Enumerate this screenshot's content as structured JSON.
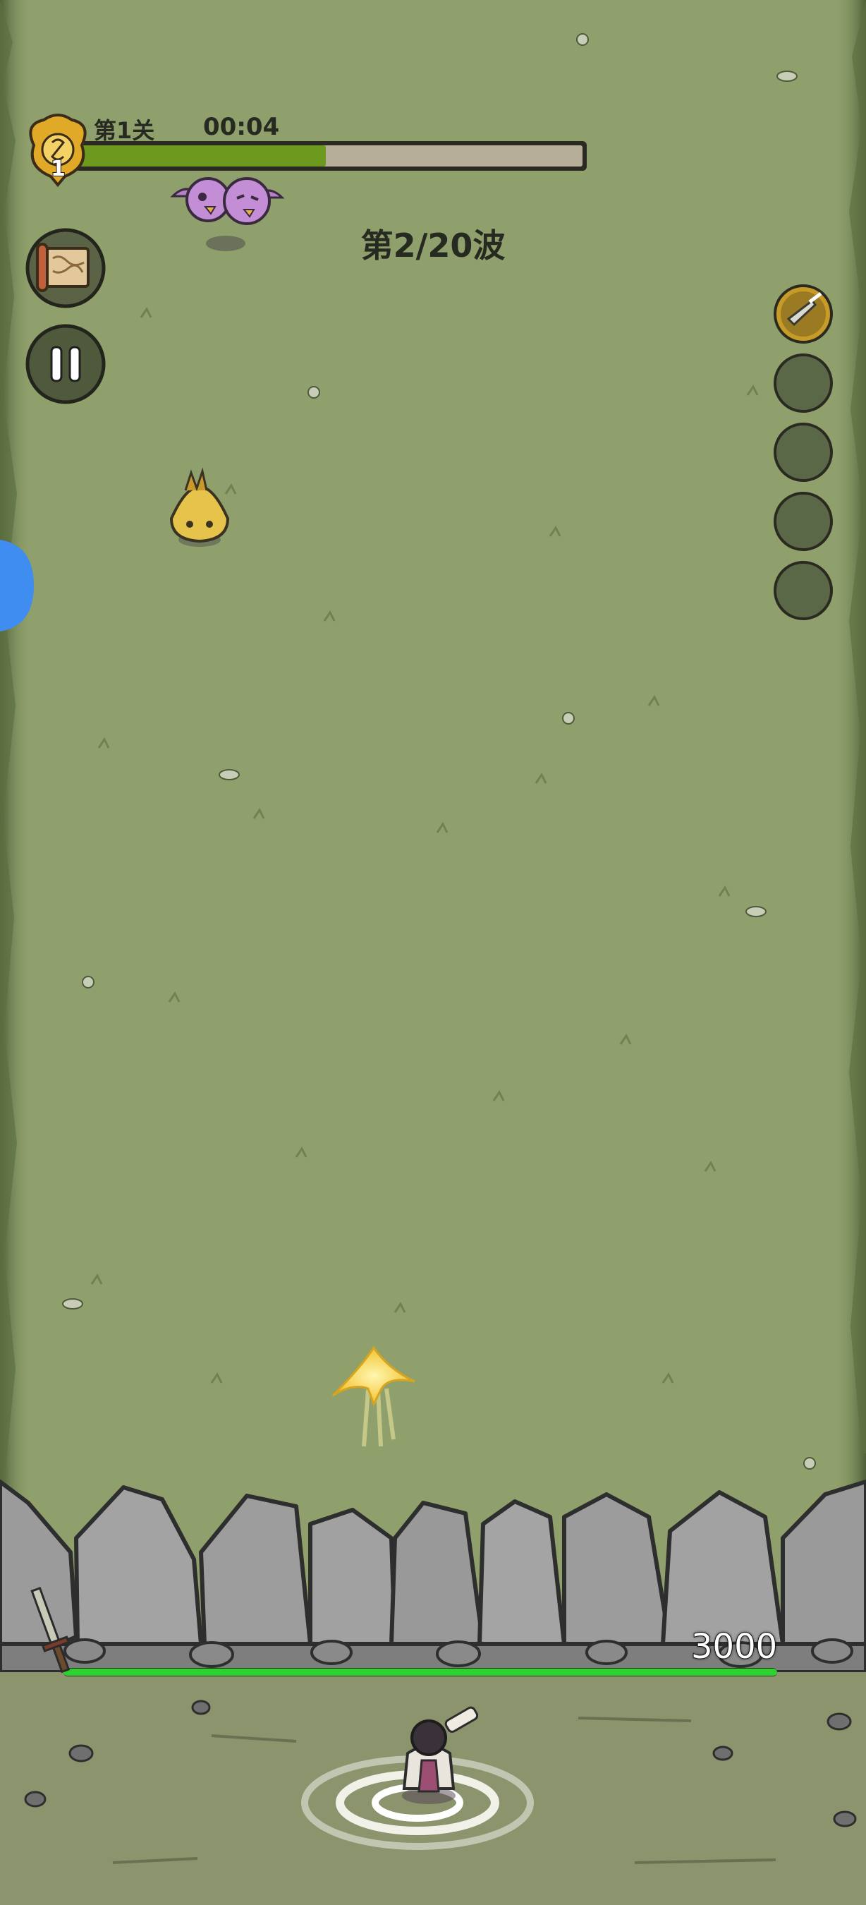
{
  "hud": {
    "stage_label": "第1关",
    "timer": "00:04",
    "level_badge": "1",
    "stage_progress": 0.49,
    "wave_label": "第2/20波"
  },
  "player": {
    "hp_text": "3000",
    "hp_fraction": 1.0
  },
  "controls": {
    "map_button_icon": "map-scroll-icon",
    "pause_button_icon": "pause-icon"
  },
  "skills": {
    "slots": [
      {
        "icon": "flying-sword-icon",
        "filled": true
      },
      {
        "icon": "empty-slot",
        "filled": false
      },
      {
        "icon": "empty-slot",
        "filled": false
      },
      {
        "icon": "empty-slot",
        "filled": false
      },
      {
        "icon": "empty-slot",
        "filled": false
      }
    ]
  },
  "colors": {
    "grass": "#8fa06c",
    "progress_fill": "#6d9a1e",
    "progress_track": "#b7ae99",
    "hp_bar": "#2fd12f",
    "stone": "#9b9b9b",
    "side_tab": "#3f8df0"
  }
}
